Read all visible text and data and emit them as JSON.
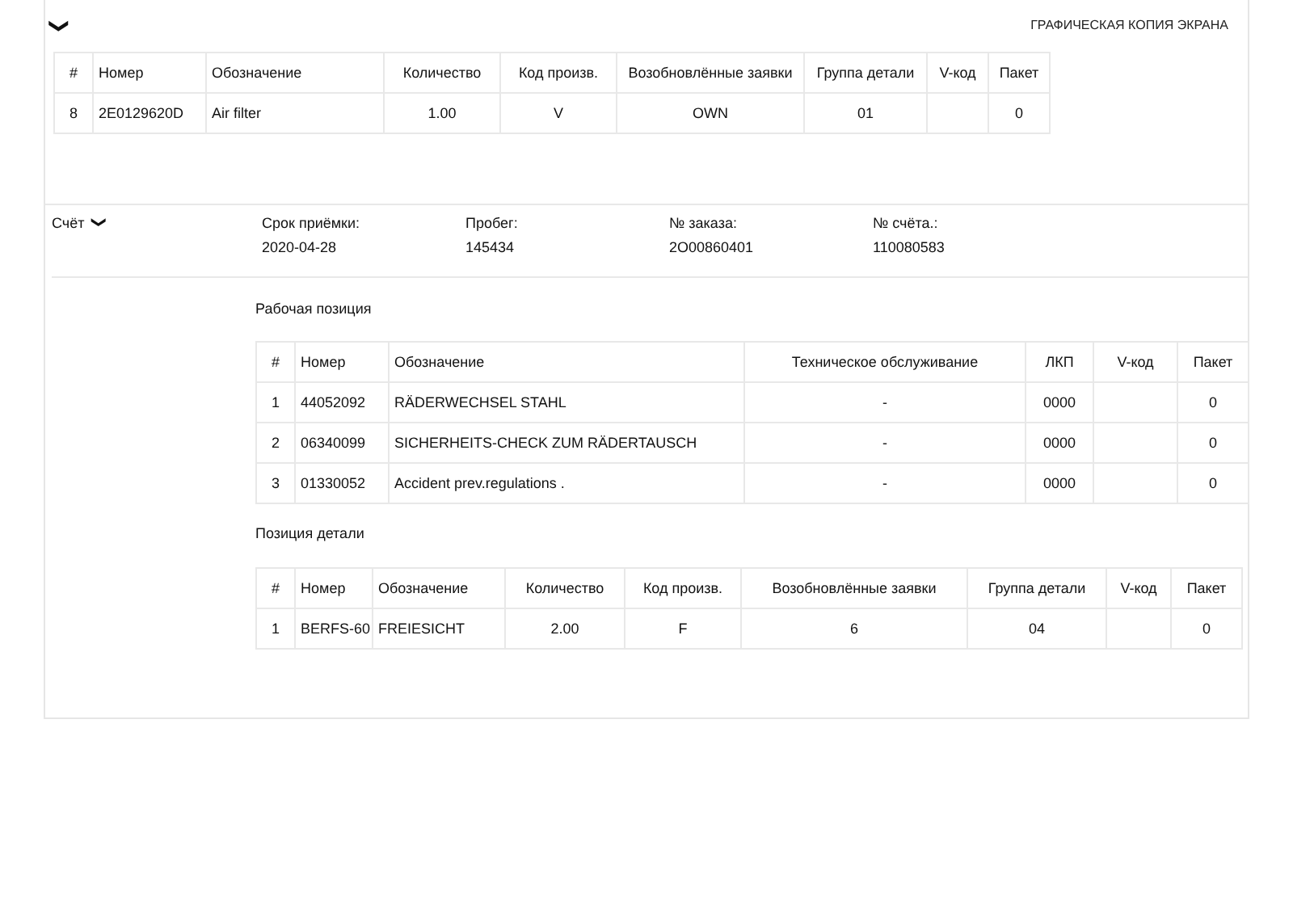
{
  "header": {
    "chevron": "❯",
    "caption": "ГРАФИЧЕСКАЯ КОПИЯ ЭКРАНА"
  },
  "parts_table": {
    "columns": [
      "#",
      "Номер",
      "Обозначение",
      "Количество",
      "Код произв.",
      "Возобновлённые заявки",
      "Группа детали",
      "V-код",
      "Пакет"
    ],
    "rows": [
      [
        "8",
        "2E0129620D",
        "Air filter",
        "1.00",
        "V",
        "OWN",
        "01",
        "",
        "0"
      ]
    ]
  },
  "invoice": {
    "label": "Счёт",
    "chevron": "❯",
    "fields": [
      {
        "label": "Срок приёмки:",
        "value": "2020-04-28"
      },
      {
        "label": "Пробег:",
        "value": "145434"
      },
      {
        "label": "№ заказа:",
        "value": "2O00860401"
      },
      {
        "label": "№ счёта.:",
        "value": "110080583"
      }
    ],
    "work_title": "Рабочая позиция",
    "work_table": {
      "columns": [
        "#",
        "Номер",
        "Обозначение",
        "Техническое обслуживание",
        "ЛКП",
        "V-код",
        "Пакет"
      ],
      "rows": [
        [
          "1",
          "44052092",
          "RÄDERWECHSEL STAHL",
          "-",
          "0000",
          "",
          "0"
        ],
        [
          "2",
          "06340099",
          "SICHERHEITS-CHECK ZUM RÄDERTAUSCH",
          "-",
          "0000",
          "",
          "0"
        ],
        [
          "3",
          "01330052",
          "Accident prev.regulations .",
          "-",
          "0000",
          "",
          "0"
        ]
      ]
    },
    "detail_title": "Позиция детали",
    "detail_table": {
      "columns": [
        "#",
        "Номер",
        "Обозначение",
        "Количество",
        "Код произв.",
        "Возобновлённые заявки",
        "Группа детали",
        "V-код",
        "Пакет"
      ],
      "rows": [
        [
          "1",
          "BERFS-60",
          "FREIESICHT",
          "2.00",
          "F",
          "6",
          "04",
          "",
          "0"
        ]
      ]
    }
  }
}
